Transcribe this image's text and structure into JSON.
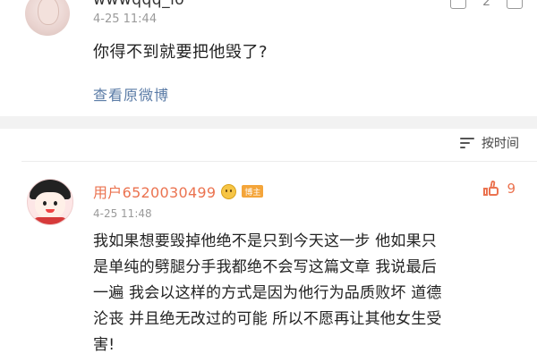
{
  "post": {
    "username": "wwwqqq_lo",
    "timestamp": "4-25 11:44",
    "body": "你得不到就要把他毁了?",
    "view_original": "查看原微博",
    "repost_count": "",
    "like_count": "2"
  },
  "sort_bar": {
    "label": "按时间",
    "icon": "sort-icon"
  },
  "comment": {
    "username": "用户6520030499",
    "badge": "博主",
    "timestamp": "4-25 11:48",
    "like_count": "9",
    "lines": [
      "我如果想要毁掉他绝不是只到今天这一步 他如果只",
      "是单纯的劈腿分手我都绝不会写这篇文章 我说最后",
      "一遍 我会以这样的方式是因为他行为品质败坏 道德",
      "沦丧 并且绝无改过的可能 所以不愿再让其他女生受",
      "害!"
    ]
  },
  "colors": {
    "username_orange": "#eb7350",
    "link_blue": "#5a7ba6",
    "band_gray": "#f2f2f2"
  }
}
